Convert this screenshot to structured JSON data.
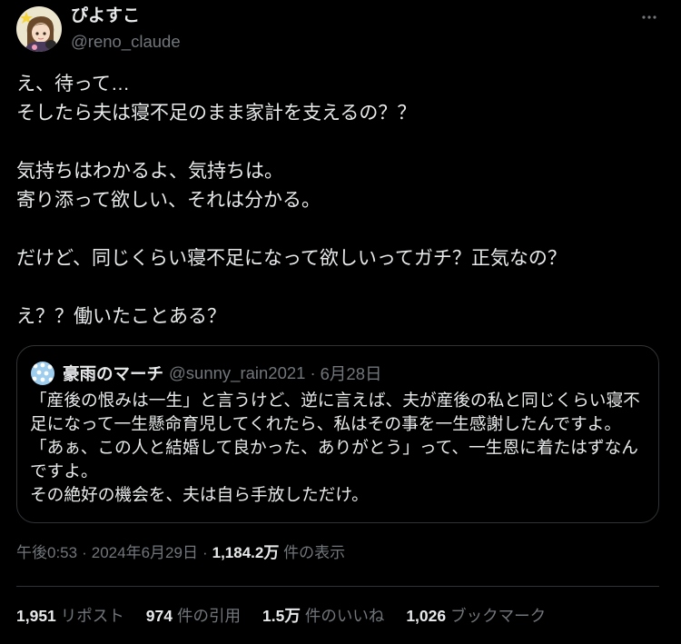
{
  "theme": {
    "background": "#000000",
    "text": "#e7e9ea",
    "muted": "#71767b",
    "border": "#2f3336"
  },
  "icons": {
    "more": "more-horizontal-icon",
    "avatar": "profile-avatar",
    "quote_avatar": "quote-author-avatar"
  },
  "author": {
    "name": "ぴよすこ",
    "handle": "@reno_claude"
  },
  "tweet": {
    "paragraphs": [
      [
        "え、待って…",
        "そしたら夫は寝不足のまま家計を支えるの？？"
      ],
      [
        "気持ちはわかるよ、気持ちは。",
        "寄り添って欲しい、それは分かる。"
      ],
      [
        "だけど、同じくらい寝不足になって欲しいってガチ？正気なの？"
      ],
      [
        "え？？働いたことある？"
      ]
    ]
  },
  "quote": {
    "author_name": "豪雨のマーチ",
    "author_handle": "@sunny_rain2021",
    "separator": "·",
    "date": "6月28日",
    "lines": [
      "「産後の恨みは一生」と言うけど、逆に言えば、夫が産後の私と同じくらい寝不",
      "足になって一生懸命育児してくれたら、私はその事を一生感謝したんですよ。",
      "「あぁ、この人と結婚して良かった、ありがとう」って、一生恩に着たはずなん",
      "ですよ。",
      "その絶好の機会を、夫は自ら手放しただけ。"
    ]
  },
  "meta": {
    "time": "午後0:53",
    "separator": "·",
    "date": "2024年6月29日",
    "views": "1,184.2万",
    "views_label": "件の表示"
  },
  "stats": [
    {
      "value": "1,951",
      "label": "リポスト"
    },
    {
      "value": "974",
      "label": "件の引用"
    },
    {
      "value": "1.5万",
      "label": "件のいいね"
    },
    {
      "value": "1,026",
      "label": "ブックマーク"
    }
  ]
}
